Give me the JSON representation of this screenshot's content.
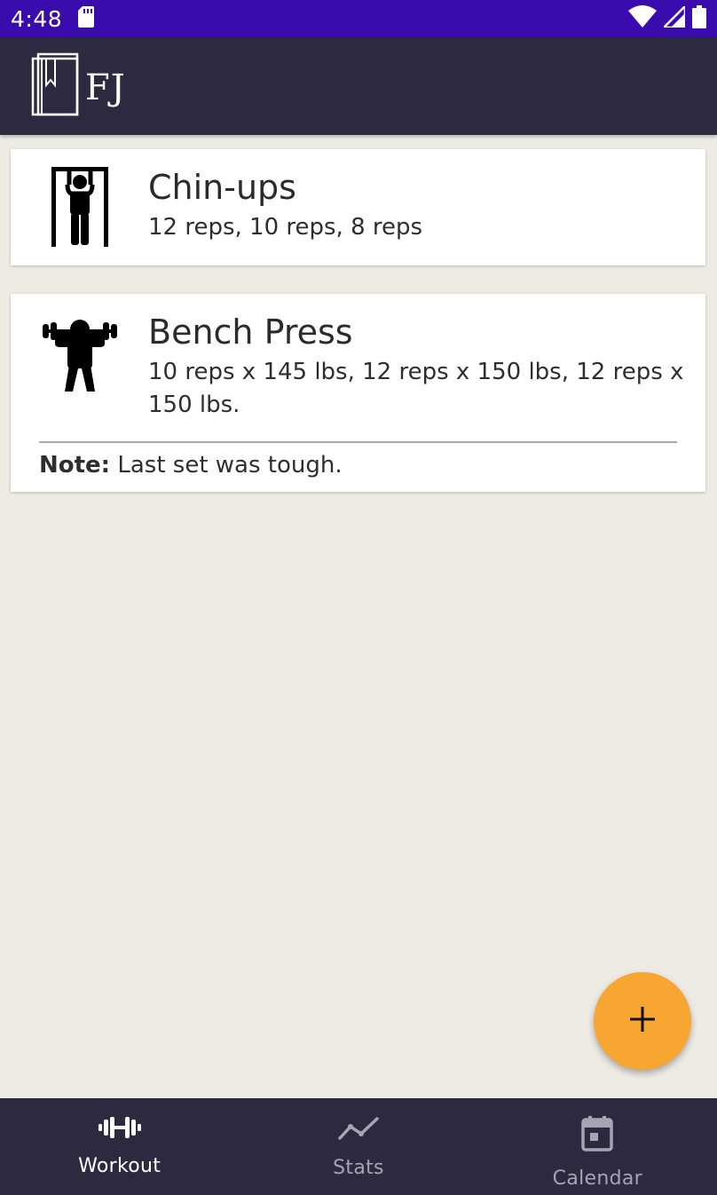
{
  "status_bar": {
    "time": "4:48",
    "icons": [
      "sd-card-icon",
      "wifi-icon",
      "signal-icon",
      "battery-icon"
    ]
  },
  "app_bar": {
    "logo_text": "FJ",
    "logo_icon": "journal-book-icon"
  },
  "exercises": [
    {
      "name": "Chin-ups",
      "icon": "chin-up-figure-icon",
      "sets": "12 reps, 10 reps, 8 reps"
    },
    {
      "name": "Bench Press",
      "icon": "dumbbell-press-figure-icon",
      "sets": "10 reps x 145 lbs, 12 reps x 150 lbs, 12 reps x 150 lbs.",
      "note_label": "Note:",
      "note_text": " Last set was tough."
    }
  ],
  "fab": {
    "icon": "plus-icon"
  },
  "bottom_nav": {
    "items": [
      {
        "label": "Workout",
        "icon": "dumbbell-icon",
        "active": true
      },
      {
        "label": "Stats",
        "icon": "trend-line-icon",
        "active": false
      },
      {
        "label": "Calendar",
        "icon": "calendar-icon",
        "active": false
      }
    ]
  },
  "colors": {
    "status_bar": "#3A0CAE",
    "app_bar": "#2C2940",
    "background": "#EEEBE5",
    "fab": "#F6A631",
    "nav_active": "#FFFFFF",
    "nav_inactive": "#A7A5B2"
  }
}
